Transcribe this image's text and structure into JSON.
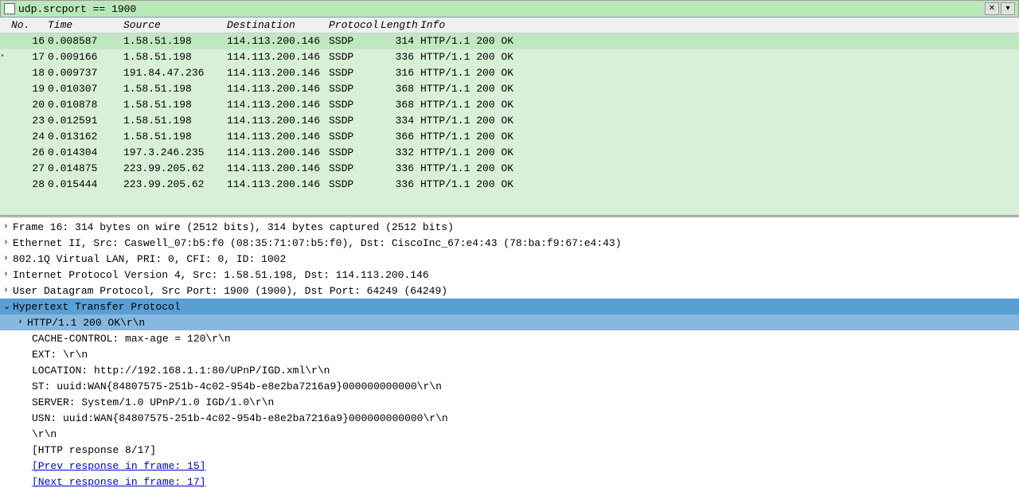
{
  "filter": {
    "value": "udp.srcport == 1900"
  },
  "headers": {
    "no": "No.",
    "time": "Time",
    "source": "Source",
    "destination": "Destination",
    "protocol": "Protocol",
    "length": "Length",
    "info": "Info"
  },
  "packets": [
    {
      "no": "16",
      "time": "0.008587",
      "source": "1.58.51.198",
      "dest": "114.113.200.146",
      "proto": "SSDP",
      "len": "314",
      "info": "HTTP/1.1 200 OK",
      "selected": true
    },
    {
      "no": "17",
      "time": "0.009166",
      "source": "1.58.51.198",
      "dest": "114.113.200.146",
      "proto": "SSDP",
      "len": "336",
      "info": "HTTP/1.1 200 OK",
      "marker": "•"
    },
    {
      "no": "18",
      "time": "0.009737",
      "source": "191.84.47.236",
      "dest": "114.113.200.146",
      "proto": "SSDP",
      "len": "316",
      "info": "HTTP/1.1 200 OK"
    },
    {
      "no": "19",
      "time": "0.010307",
      "source": "1.58.51.198",
      "dest": "114.113.200.146",
      "proto": "SSDP",
      "len": "368",
      "info": "HTTP/1.1 200 OK"
    },
    {
      "no": "20",
      "time": "0.010878",
      "source": "1.58.51.198",
      "dest": "114.113.200.146",
      "proto": "SSDP",
      "len": "368",
      "info": "HTTP/1.1 200 OK"
    },
    {
      "no": "23",
      "time": "0.012591",
      "source": "1.58.51.198",
      "dest": "114.113.200.146",
      "proto": "SSDP",
      "len": "334",
      "info": "HTTP/1.1 200 OK"
    },
    {
      "no": "24",
      "time": "0.013162",
      "source": "1.58.51.198",
      "dest": "114.113.200.146",
      "proto": "SSDP",
      "len": "366",
      "info": "HTTP/1.1 200 OK"
    },
    {
      "no": "26",
      "time": "0.014304",
      "source": "197.3.246.235",
      "dest": "114.113.200.146",
      "proto": "SSDP",
      "len": "332",
      "info": "HTTP/1.1 200 OK"
    },
    {
      "no": "27",
      "time": "0.014875",
      "source": "223.99.205.62",
      "dest": "114.113.200.146",
      "proto": "SSDP",
      "len": "336",
      "info": "HTTP/1.1 200 OK"
    },
    {
      "no": "28",
      "time": "0.015444",
      "source": "223.99.205.62",
      "dest": "114.113.200.146",
      "proto": "SSDP",
      "len": "336",
      "info": "HTTP/1.1 200 OK"
    }
  ],
  "details": {
    "frame": "Frame 16: 314 bytes on wire (2512 bits), 314 bytes captured (2512 bits)",
    "ethernet": "Ethernet II, Src: Caswell_07:b5:f0 (08:35:71:07:b5:f0), Dst: CiscoInc_67:e4:43 (78:ba:f9:67:e4:43)",
    "vlan": "802.1Q Virtual LAN, PRI: 0, CFI: 0, ID: 1002",
    "ip": "Internet Protocol Version 4, Src: 1.58.51.198, Dst: 114.113.200.146",
    "udp": "User Datagram Protocol, Src Port: 1900 (1900), Dst Port: 64249 (64249)",
    "http_header": "Hypertext Transfer Protocol",
    "http_status": "HTTP/1.1 200 OK\\r\\n",
    "cache_control": "CACHE-CONTROL: max-age = 120\\r\\n",
    "ext": "EXT: \\r\\n",
    "location": "LOCATION: http://192.168.1.1:80/UPnP/IGD.xml\\r\\n",
    "st": "ST: uuid:WAN{84807575-251b-4c02-954b-e8e2ba7216a9}000000000000\\r\\n",
    "server": "SERVER: System/1.0 UPnP/1.0 IGD/1.0\\r\\n",
    "usn": "USN: uuid:WAN{84807575-251b-4c02-954b-e8e2ba7216a9}000000000000\\r\\n",
    "crlf": "\\r\\n",
    "response_num": "[HTTP response 8/17]",
    "prev_link": "[Prev response in frame: 15]",
    "next_link": "[Next response in frame: 17]"
  },
  "controls": {
    "clear": "✕",
    "dropdown": "▾"
  }
}
